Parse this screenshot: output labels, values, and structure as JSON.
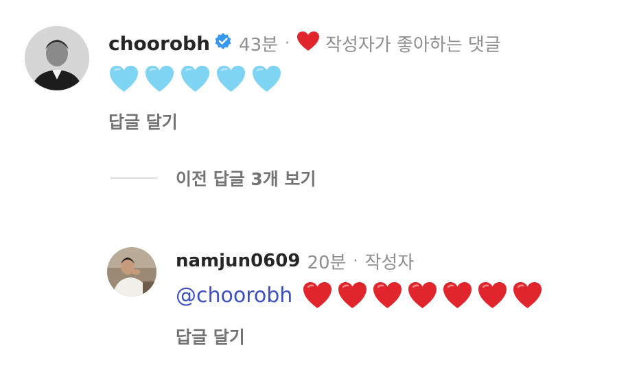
{
  "comment": {
    "username": "choorobh",
    "time": "43분",
    "author_liked_label": "작성자가 좋아하는 댓글",
    "reply_label": "답글 달기",
    "body_hearts": [
      "light-blue-heart",
      "light-blue-heart",
      "light-blue-heart",
      "light-blue-heart",
      "light-blue-heart"
    ],
    "colors": {
      "light_blue_heart": "#7fd3f3",
      "red_heart": "#e0262c",
      "verified": "#3897f0"
    }
  },
  "view_previous_replies": "이전 답글 3개 보기",
  "reply": {
    "username": "namjun0609",
    "time": "20분",
    "author_label": "작성자",
    "mention": "@choorobh",
    "body_hearts": [
      "red-heart",
      "red-heart",
      "red-heart",
      "red-heart",
      "red-heart",
      "red-heart",
      "red-heart"
    ],
    "reply_label": "답글 달기"
  },
  "separator": "·"
}
